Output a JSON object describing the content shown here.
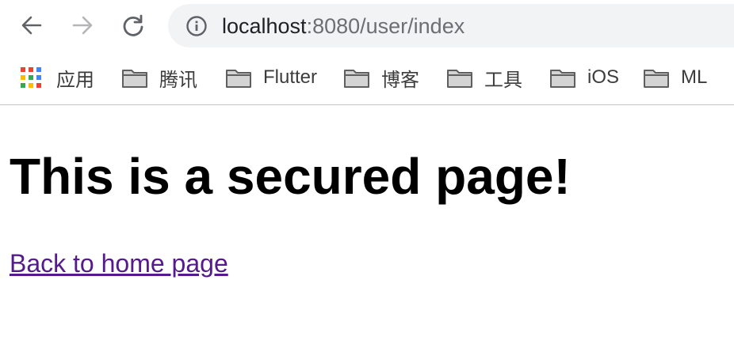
{
  "toolbar": {
    "back_icon": "arrow-left-icon",
    "forward_icon": "arrow-right-icon",
    "reload_icon": "reload-icon",
    "address": {
      "info_icon": "info-circle-icon",
      "host": "localhost",
      "rest": ":8080/user/index"
    }
  },
  "bookmarks": {
    "apps_label": "应用",
    "items": [
      {
        "label": "腾讯",
        "icon": "folder-icon"
      },
      {
        "label": "Flutter",
        "icon": "folder-icon"
      },
      {
        "label": "博客",
        "icon": "folder-icon"
      },
      {
        "label": "工具",
        "icon": "folder-icon"
      },
      {
        "label": "iOS",
        "icon": "folder-icon"
      },
      {
        "label": "ML",
        "icon": "folder-icon"
      }
    ]
  },
  "page": {
    "title": "This is a secured page!",
    "back_link": "Back to home page"
  },
  "colors": {
    "link_visited": "#551a8b",
    "omnibox_bg": "#f1f3f4",
    "url_host": "#202124",
    "url_rest": "#6b6e73"
  }
}
